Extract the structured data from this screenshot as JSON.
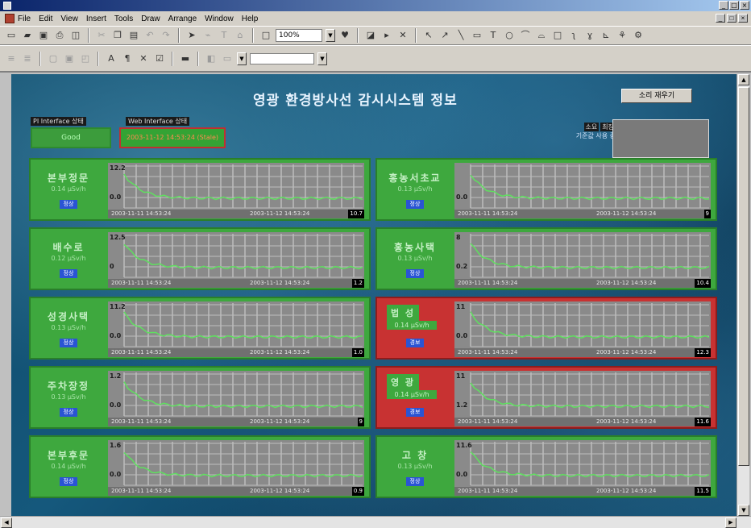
{
  "window": {
    "title": "",
    "controls": [
      "_",
      "□",
      "×"
    ]
  },
  "menu": {
    "items": [
      "File",
      "Edit",
      "View",
      "Insert",
      "Tools",
      "Draw",
      "Arrange",
      "Window",
      "Help"
    ]
  },
  "toolbar": {
    "zoom": "100%"
  },
  "header": {
    "title": "영광 환경방사선 감시시스템 정보",
    "sound_button": "소리 재우기"
  },
  "interfaces": [
    {
      "label": "PI Interface 상태",
      "status": "Good",
      "alert": false
    },
    {
      "label": "Web Interface 상태",
      "status": "2003-11-12 14:53:24 (Stale)",
      "alert": true
    }
  ],
  "mini_legend": {
    "a": "소요",
    "b": "최장",
    "note": "기준값 사용 중"
  },
  "colors": {
    "normal_panel": "#3ea83e",
    "alarm_panel": "#c83232",
    "trend_line": "#5fe05f",
    "badge": "#2a54d4"
  },
  "stations": [
    {
      "name": "본부정문",
      "value": "0.14 μSv/h",
      "badge": "정상",
      "alarm": false,
      "y_top": "12.2",
      "y_bot": "0.0",
      "start": "2003-11-11 14:53:24",
      "end": "2003-11-12 14:53:24",
      "right": "10.7"
    },
    {
      "name": "홍농서초교",
      "value": "0.13 μSv/h",
      "badge": "정상",
      "alarm": false,
      "y_top": "",
      "y_bot": "0.0",
      "start": "2003-11-11 14:53:24",
      "end": "2003-11-12 14:53:24",
      "right": "9"
    },
    {
      "name": "배수로",
      "value": "0.12 μSv/h",
      "badge": "정상",
      "alarm": false,
      "y_top": "12.5",
      "y_bot": "0",
      "start": "2003-11-11 14:53:24",
      "end": "2003-11-12 14:53:24",
      "right": "1.2"
    },
    {
      "name": "홍농사택",
      "value": "0.13 μSv/h",
      "badge": "정상",
      "alarm": false,
      "y_top": "8",
      "y_bot": "0.2",
      "start": "2003-11-11 14:53:24",
      "end": "2003-11-12 14:53:24",
      "right": "10.4"
    },
    {
      "name": "성경사택",
      "value": "0.13 μSv/h",
      "badge": "정상",
      "alarm": false,
      "y_top": "11.2",
      "y_bot": "0.0",
      "start": "2003-11-11 14:53:24",
      "end": "2003-11-12 14:53:24",
      "right": "1.0"
    },
    {
      "name": "법 성",
      "value": "0.14 μSv/h",
      "badge": "경보",
      "alarm": true,
      "y_top": "11",
      "y_bot": "0.0",
      "start": "2003-11-11 14:53:24",
      "end": "2003-11-12 14:53:24",
      "right": "12.3"
    },
    {
      "name": "주차장정",
      "value": "0.13 μSv/h",
      "badge": "정상",
      "alarm": false,
      "y_top": "1.2",
      "y_bot": "0.0",
      "start": "2003-11-11 14:53:24",
      "end": "2003-11-12 14:53:24",
      "right": "9"
    },
    {
      "name": "영 광",
      "value": "0.14 μSv/h",
      "badge": "경보",
      "alarm": true,
      "y_top": "11",
      "y_bot": "1.2",
      "start": "2003-11-11 14:53:24",
      "end": "2003-11-12 14:53:24",
      "right": "11.6"
    },
    {
      "name": "본부후문",
      "value": "0.14 μSv/h",
      "badge": "정상",
      "alarm": false,
      "y_top": "1.6",
      "y_bot": "0.0",
      "start": "2003-11-11 14:53:24",
      "end": "2003-11-12 14:53:24",
      "right": "0.9"
    },
    {
      "name": "고 창",
      "value": "0.13 μSv/h",
      "badge": "정상",
      "alarm": false,
      "y_top": "11.6",
      "y_bot": "0.0",
      "start": "2003-11-11 14:53:24",
      "end": "2003-11-12 14:53:24",
      "right": "11.5"
    }
  ]
}
